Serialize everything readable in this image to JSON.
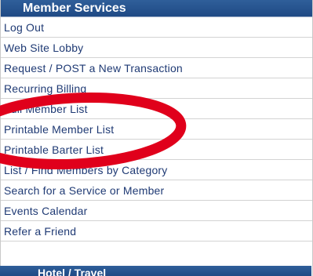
{
  "panel": {
    "title": "Member Services",
    "items": [
      {
        "label": "Log Out"
      },
      {
        "label": "Web Site Lobby"
      },
      {
        "label": "Request / POST a New Transaction"
      },
      {
        "label": "Recurring Billing"
      },
      {
        "label": "Full Member List"
      },
      {
        "label": "Printable Member List"
      },
      {
        "label": "Printable Barter List"
      },
      {
        "label": "List / Find Members by Category"
      },
      {
        "label": "Search for a Service or Member"
      },
      {
        "label": "Events Calendar"
      },
      {
        "label": "Refer a Friend"
      }
    ]
  },
  "next_section": {
    "title": "Hotel / Travel"
  },
  "colors": {
    "header_blue": "#1f4a85",
    "link_text": "#1f3a74",
    "highlight_circle": "#e0001b"
  }
}
